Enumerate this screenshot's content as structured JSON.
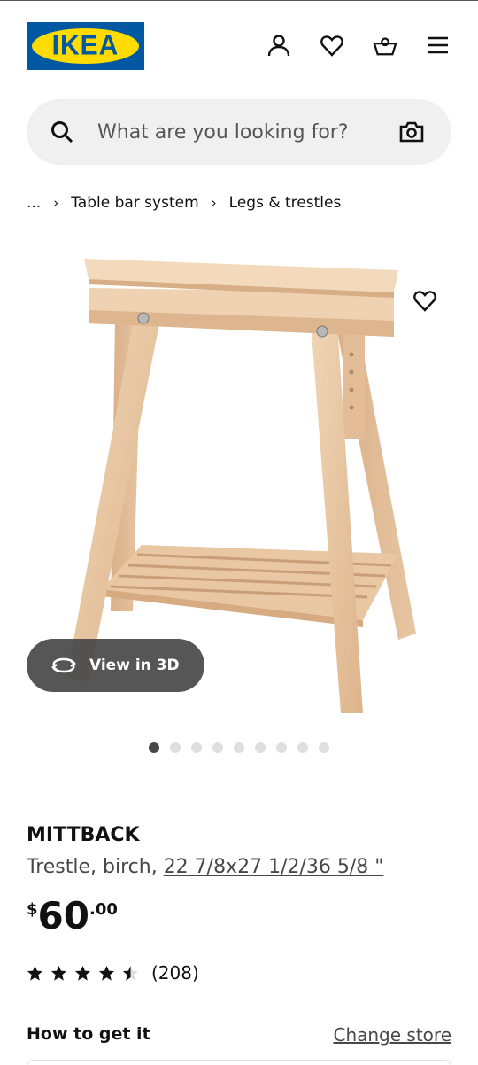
{
  "brand": {
    "logo_text": "IKEA",
    "blue": "#0058a3",
    "yellow": "#ffdb00"
  },
  "header": {
    "icons": [
      "person-icon",
      "heart-icon",
      "shopping-basket-icon",
      "hamburger-menu-icon"
    ]
  },
  "search": {
    "placeholder": "What are you looking for?",
    "value": "",
    "left_icon": "search-icon",
    "right_icon": "camera-icon"
  },
  "breadcrumb": {
    "ellipsis": "...",
    "items": [
      "Table bar system",
      "Legs & trestles"
    ]
  },
  "gallery": {
    "view_3d_label": "View in 3D",
    "image_count": 9,
    "active_index": 0
  },
  "product": {
    "name": "MITTBACK",
    "description": "Trestle, birch, ",
    "size": "22 7/8x27 1/2/36 5/8 \"",
    "price": {
      "currency": "$",
      "integer": "60",
      "decimal": ".00"
    },
    "rating": {
      "value": 4.5,
      "max": 5,
      "count_text": "(208)"
    }
  },
  "availability": {
    "heading": "How to get it",
    "change_store": "Change store"
  }
}
